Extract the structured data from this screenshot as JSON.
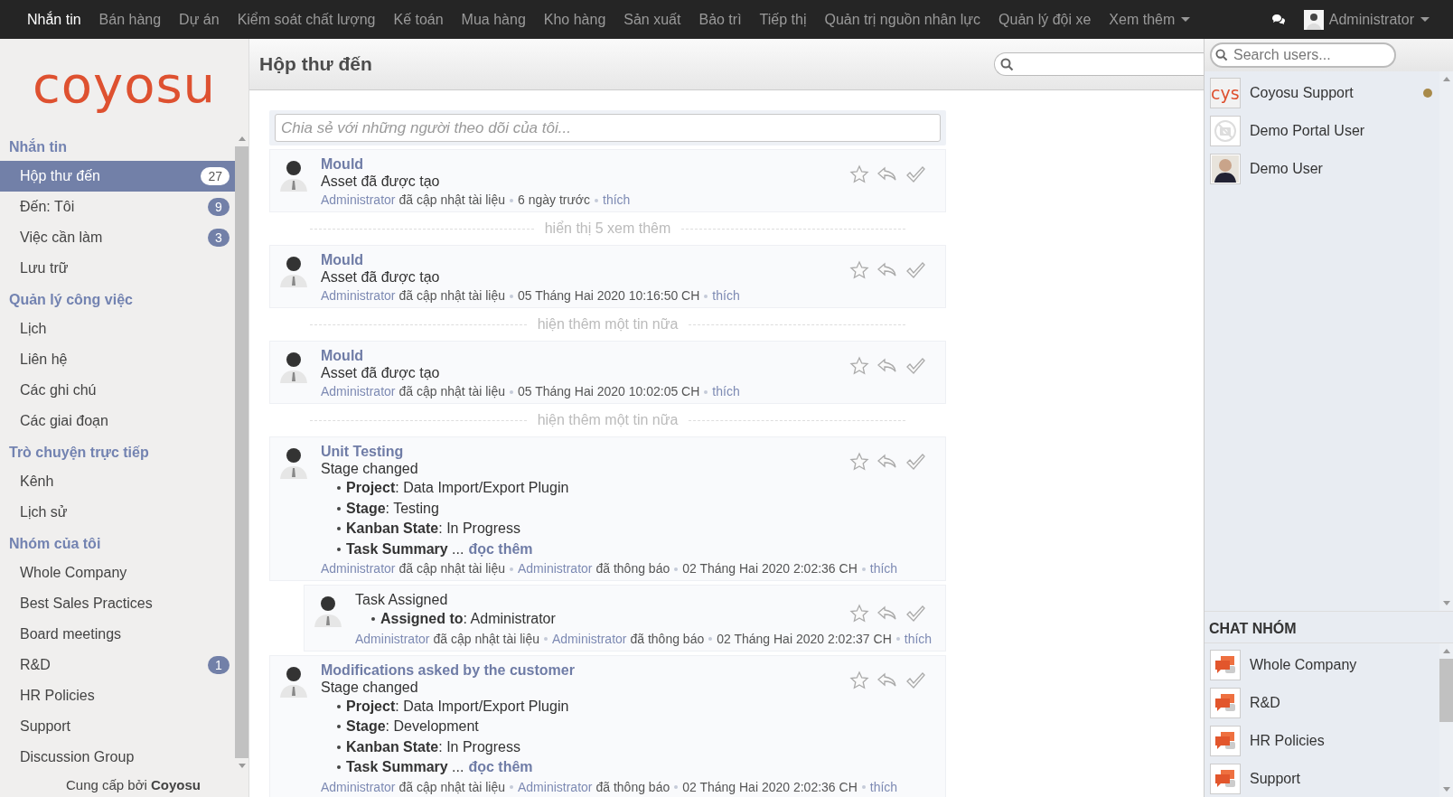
{
  "top_nav": {
    "items": [
      {
        "label": "Nhắn tin",
        "selected": true
      },
      {
        "label": "Bán hàng",
        "selected": false
      },
      {
        "label": "Dự án",
        "selected": false
      },
      {
        "label": "Kiểm soát chất lượng",
        "selected": false
      },
      {
        "label": "Kế toán",
        "selected": false
      },
      {
        "label": "Mua hàng",
        "selected": false
      },
      {
        "label": "Kho hàng",
        "selected": false
      },
      {
        "label": "Sản xuất",
        "selected": false
      },
      {
        "label": "Bảo trì",
        "selected": false
      },
      {
        "label": "Tiếp thị",
        "selected": false
      },
      {
        "label": "Quản trị nguồn nhân lực",
        "selected": false
      },
      {
        "label": "Quản lý đội xe",
        "selected": false
      },
      {
        "label": "Xem thêm",
        "selected": false,
        "dropdown": true
      }
    ],
    "user": {
      "name": "Administrator"
    }
  },
  "sidebar": {
    "logo": "coyosu",
    "sections": [
      {
        "title": "Nhắn tin",
        "items": [
          {
            "label": "Hộp thư đến",
            "count": "27",
            "selected": true
          },
          {
            "label": "Đến: Tôi",
            "count": "9",
            "selected": false
          },
          {
            "label": "Việc cần làm",
            "count": "3",
            "selected": false
          },
          {
            "label": "Lưu trữ",
            "selected": false
          }
        ]
      },
      {
        "title": "Quản lý công việc",
        "items": [
          {
            "label": "Lịch",
            "selected": false
          },
          {
            "label": "Liên hệ",
            "selected": false
          },
          {
            "label": "Các ghi chú",
            "selected": false
          },
          {
            "label": "Các giai đoạn",
            "selected": false
          }
        ]
      },
      {
        "title": "Trò chuyện trực tiếp",
        "items": [
          {
            "label": "Kênh",
            "selected": false
          },
          {
            "label": "Lịch sử",
            "selected": false
          }
        ]
      },
      {
        "title": "Nhóm của tôi",
        "items": [
          {
            "label": "Whole Company",
            "selected": false
          },
          {
            "label": "Best Sales Practices",
            "selected": false
          },
          {
            "label": "Board meetings",
            "selected": false
          },
          {
            "label": "R&D",
            "count": "1",
            "selected": false
          },
          {
            "label": "HR Policies",
            "selected": false
          },
          {
            "label": "Support",
            "selected": false
          },
          {
            "label": "Discussion Group",
            "selected": false
          }
        ]
      }
    ],
    "footer": "Cung cấp bởi **Coyosu**"
  },
  "main": {
    "title": "Hộp thư đến",
    "compose": {
      "placeholder": "Chia sẻ với những người theo dõi của tôi..."
    },
    "feed": [
      {
        "kind": "message",
        "reply": false,
        "title": "Mould",
        "subtitle": "Asset đã được tạo",
        "meta": [
          [
            {
              "kind": "author",
              "text": "Administrator"
            },
            {
              "kind": "plain",
              "text": "đã cập nhật tài liệu"
            }
          ],
          [
            {
              "kind": "plain",
              "text": "6 ngày trước"
            }
          ],
          [
            {
              "kind": "link",
              "text": "thích"
            }
          ]
        ]
      },
      {
        "kind": "expander",
        "text": "hiển thị 5 xem thêm"
      },
      {
        "kind": "message",
        "reply": false,
        "title": "Mould",
        "subtitle": "Asset đã được tạo",
        "meta": [
          [
            {
              "kind": "author",
              "text": "Administrator"
            },
            {
              "kind": "plain",
              "text": "đã cập nhật tài liệu"
            }
          ],
          [
            {
              "kind": "plain",
              "text": "05 Tháng Hai 2020 10:16:50 CH"
            }
          ],
          [
            {
              "kind": "link",
              "text": "thích"
            }
          ]
        ]
      },
      {
        "kind": "expander",
        "text": "hiện thêm một tin nữa"
      },
      {
        "kind": "message",
        "reply": false,
        "title": "Mould",
        "subtitle": "Asset đã được tạo",
        "meta": [
          [
            {
              "kind": "author",
              "text": "Administrator"
            },
            {
              "kind": "plain",
              "text": "đã cập nhật tài liệu"
            }
          ],
          [
            {
              "kind": "plain",
              "text": "05 Tháng Hai 2020 10:02:05 CH"
            }
          ],
          [
            {
              "kind": "link",
              "text": "thích"
            }
          ]
        ]
      },
      {
        "kind": "expander",
        "text": "hiện thêm một tin nữa"
      },
      {
        "kind": "message",
        "reply": false,
        "title": "Unit Testing",
        "subtitle": "Stage changed",
        "bullets": [
          {
            "text": "**Project**: Data Import/Export Plugin"
          },
          {
            "text": "**Stage**: Testing"
          },
          {
            "text": "**Kanban State**: In Progress"
          },
          {
            "text": "**Task Summary** ...",
            "link": "đọc thêm"
          }
        ],
        "meta": [
          [
            {
              "kind": "author",
              "text": "Administrator"
            },
            {
              "kind": "plain",
              "text": "đã cập nhật tài liệu"
            }
          ],
          [
            {
              "kind": "author",
              "text": "Administrator"
            },
            {
              "kind": "plain",
              "text": "đã thông báo"
            }
          ],
          [
            {
              "kind": "plain",
              "text": "02 Tháng Hai 2020 2:02:36 CH"
            }
          ],
          [
            {
              "kind": "link",
              "text": "thích"
            }
          ]
        ]
      },
      {
        "kind": "message",
        "reply": true,
        "subtitle": "Task Assigned",
        "bullets": [
          {
            "text": "**Assigned to**: Administrator"
          }
        ],
        "meta": [
          [
            {
              "kind": "author",
              "text": "Administrator"
            },
            {
              "kind": "plain",
              "text": "đã cập nhật tài liệu"
            }
          ],
          [
            {
              "kind": "author",
              "text": "Administrator"
            },
            {
              "kind": "plain",
              "text": "đã thông báo"
            }
          ],
          [
            {
              "kind": "plain",
              "text": "02 Tháng Hai 2020 2:02:37 CH"
            }
          ],
          [
            {
              "kind": "link",
              "text": "thích"
            }
          ]
        ]
      },
      {
        "kind": "message",
        "reply": false,
        "title": "Modifications asked by the customer",
        "subtitle": "Stage changed",
        "bullets": [
          {
            "text": "**Project**: Data Import/Export Plugin"
          },
          {
            "text": "**Stage**: Development"
          },
          {
            "text": "**Kanban State**: In Progress"
          },
          {
            "text": "**Task Summary** ...",
            "link": "đọc thêm"
          }
        ],
        "meta": [
          [
            {
              "kind": "author",
              "text": "Administrator"
            },
            {
              "kind": "plain",
              "text": "đã cập nhật tài liệu"
            }
          ],
          [
            {
              "kind": "author",
              "text": "Administrator"
            },
            {
              "kind": "plain",
              "text": "đã thông báo"
            }
          ],
          [
            {
              "kind": "plain",
              "text": "02 Tháng Hai 2020 2:02:36 CH"
            }
          ],
          [
            {
              "kind": "link",
              "text": "thích"
            }
          ]
        ]
      }
    ]
  },
  "chat_panel": {
    "search": {
      "placeholder": "Search users..."
    },
    "users": [
      {
        "name": "Coyosu Support",
        "kind": "logo",
        "avatar_text": "cys",
        "online": true
      },
      {
        "name": "Demo Portal User",
        "kind": "none",
        "online": false
      },
      {
        "name": "Demo User",
        "kind": "photo",
        "online": false
      }
    ],
    "groups_title": "CHAT NHÓM",
    "groups": [
      {
        "name": "Whole Company"
      },
      {
        "name": "R&D"
      },
      {
        "name": "HR Policies"
      },
      {
        "name": "Support"
      }
    ]
  }
}
